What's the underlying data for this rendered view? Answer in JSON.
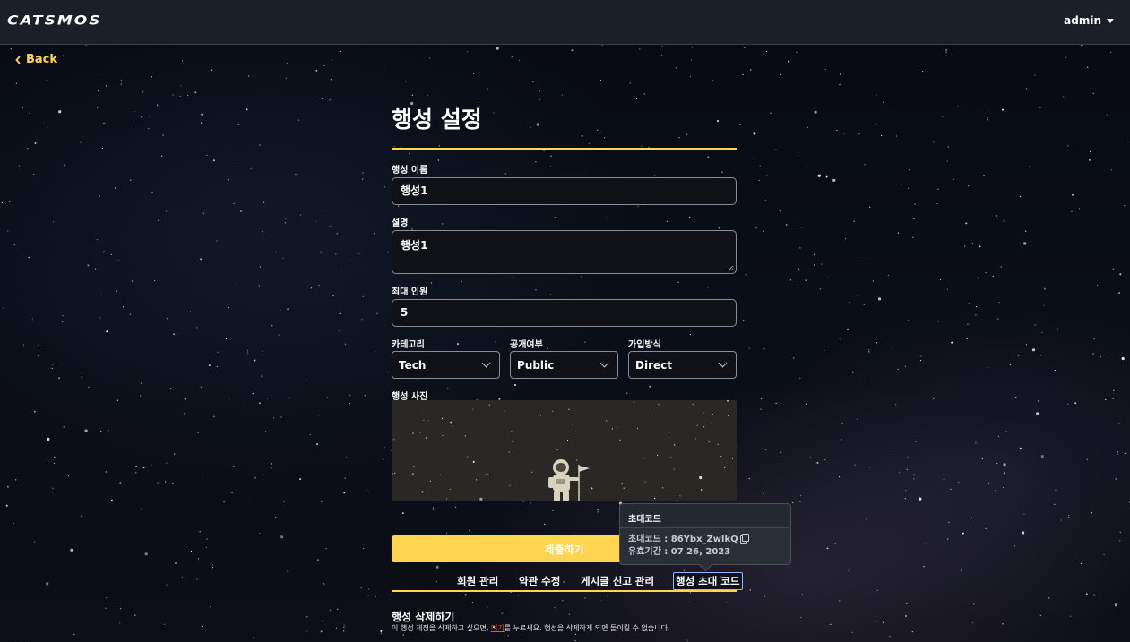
{
  "header": {
    "logo": "CATSMOS",
    "user_menu_label": "admin"
  },
  "nav": {
    "back_label": "Back"
  },
  "form": {
    "title": "행성 설정",
    "name_label": "행성 이름",
    "name_value": "행성1",
    "description_label": "설명",
    "description_value": "행성1",
    "max_members_label": "최대 인원",
    "max_members_value": "5",
    "category_label": "카테고리",
    "category_value": "Tech",
    "visibility_label": "공개여부",
    "visibility_value": "Public",
    "join_method_label": "가입방식",
    "join_method_value": "Direct",
    "photo_label": "행성 사진",
    "submit_label": "제출하기"
  },
  "tabs": [
    {
      "label": "회원 관리"
    },
    {
      "label": "약관 수정"
    },
    {
      "label": "게시글 신고 관리"
    },
    {
      "label": "행성 초대 코드"
    }
  ],
  "active_tab": "행성 초대 코드",
  "delete_section": {
    "title": "행성 삭제하기",
    "desc_before": "이 행성 체정을 삭제하고 싶으면, ",
    "link_text": "여기",
    "desc_after": "를 누르세요. 행성을 삭제하게 되면 돌이킬 수 없습니다."
  },
  "invite_popover": {
    "title": "초대코드",
    "code_text": "초대코드 : 86Ybx_ZwlkQ",
    "expiry_text": "유효기간 : 07 26, 2023"
  },
  "colors": {
    "accent": "#ffd44f",
    "header_bg": "#1b1f28",
    "danger": "#ff4d4d"
  },
  "icons": [
    "chevron-left-icon",
    "caret-down-icon",
    "chevron-down-icon",
    "copy-icon",
    "astronaut-icon",
    "flag-icon"
  ]
}
